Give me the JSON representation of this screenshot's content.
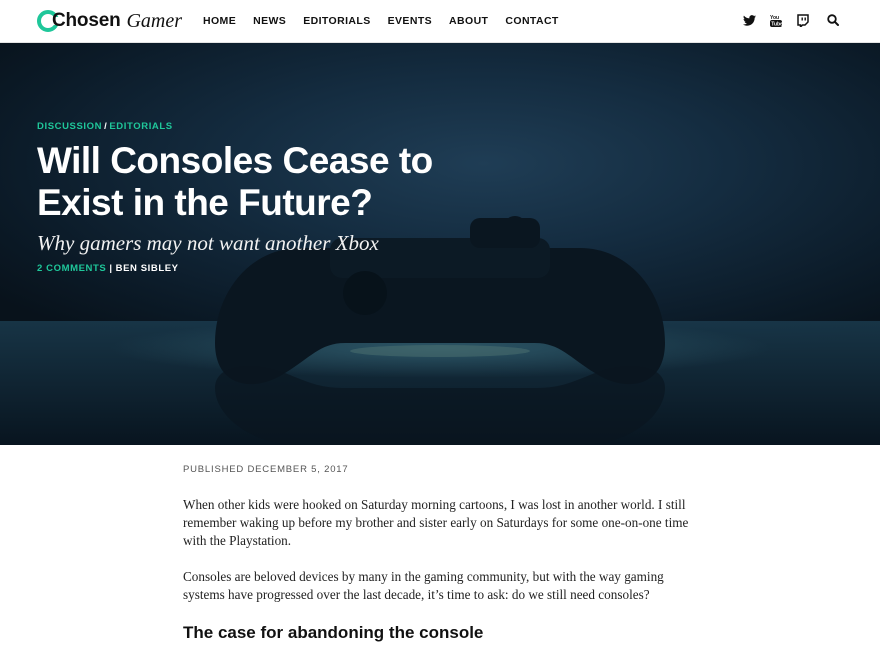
{
  "header": {
    "logo": {
      "word1": "Chosen",
      "word2": "Gamer"
    },
    "nav": [
      {
        "label": "HOME"
      },
      {
        "label": "NEWS"
      },
      {
        "label": "EDITORIALS"
      },
      {
        "label": "EVENTS"
      },
      {
        "label": "ABOUT"
      },
      {
        "label": "CONTACT"
      }
    ],
    "social_icons": [
      "twitter-icon",
      "youtube-icon",
      "twitch-icon",
      "search-icon"
    ]
  },
  "hero": {
    "categories": [
      "DISCUSSION",
      "EDITORIALS"
    ],
    "category_separator": "/",
    "title": "Will Consoles Cease to Exist in the Future?",
    "subtitle": "Why gamers may not want another Xbox",
    "comments": "2 COMMENTS",
    "meta_separator": "|",
    "author": "BEN SIBLEY"
  },
  "article": {
    "published": "PUBLISHED DECEMBER 5, 2017",
    "paragraphs": [
      "When other kids were hooked on Saturday morning cartoons, I was lost in another world. I still remember waking up before my brother and sister early on Saturdays for some one-on-one time with the Playstation.",
      "Consoles are beloved devices by many in the gaming community, but with the way gaming systems have progressed over the last decade, it’s time to ask: do we still need consoles?"
    ],
    "heading": "The case for abandoning the console"
  },
  "colors": {
    "accent": "#1fc79a",
    "hero_dark": "#0b1a27",
    "text": "#222222"
  }
}
